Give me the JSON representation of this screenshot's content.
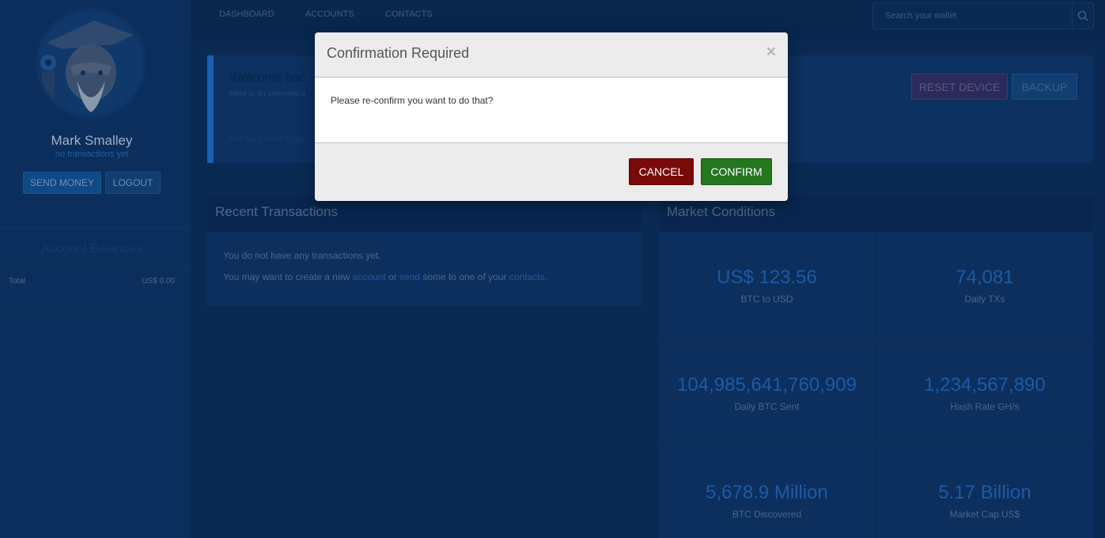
{
  "sidebar": {
    "user_name": "Mark Smalley",
    "user_status": "no transactions yet",
    "send_money_label": "SEND MONEY",
    "logout_label": "LOGOUT",
    "balances_title": "Account Balances",
    "total_label": "Total",
    "total_value": "US$ 0.00"
  },
  "nav": {
    "items": [
      "DASHBOARD",
      "ACCOUNTS",
      "CONTACTS"
    ],
    "search_placeholder": "Search your wallet",
    "search_icon": "search-icon"
  },
  "welcome": {
    "title": "Welcome bac",
    "subtitle": "Here is an overview o",
    "note": "Not sure what to pu",
    "reset_label": "RESET DEVICE",
    "backup_label": "BACKUP"
  },
  "recent": {
    "title": "Recent Transactions",
    "line1": "You do not have any transactions yet.",
    "line2_pre": "You may want to create a new ",
    "line2_link1": "account",
    "line2_mid1": " or ",
    "line2_link2": "send",
    "line2_mid2": " some to one of your ",
    "line2_link3": "contacts",
    "line2_end": "."
  },
  "market": {
    "title": "Market Conditions",
    "stats": [
      {
        "value": "US$ 123.56",
        "label": "BTC to USD"
      },
      {
        "value": "74,081",
        "label": "Daily TXs"
      },
      {
        "value": "104,985,641,760,909",
        "label": "Daily BTC Sent"
      },
      {
        "value": "1,234,567,890",
        "label": "Hash Rate GH/s"
      },
      {
        "value": "5,678.9 Million",
        "label": "BTC Discovered"
      },
      {
        "value": "5.17 Billion",
        "label": "Market Cap US$"
      }
    ]
  },
  "modal": {
    "title": "Confirmation Required",
    "close_glyph": "×",
    "message": "Please re-confirm you want to do that?",
    "cancel_label": "CANCEL",
    "confirm_label": "CONFIRM"
  },
  "colors": {
    "cancel": "#7a0a0a",
    "confirm": "#24761f",
    "accent": "#1b5fae"
  }
}
